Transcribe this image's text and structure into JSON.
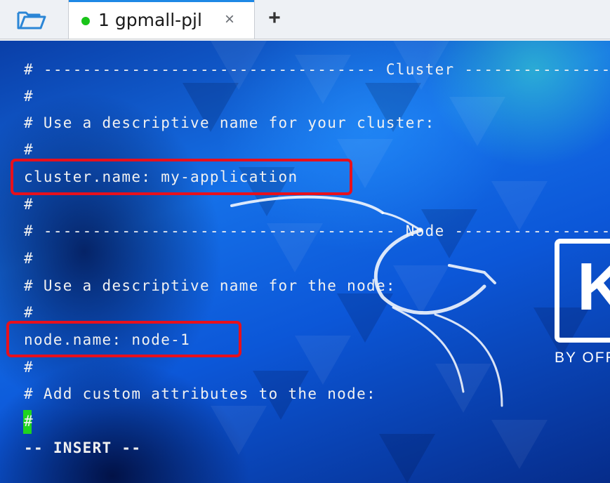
{
  "tabbar": {
    "folder_icon": "folder-open-icon",
    "active_tab": {
      "label": "1 gpmall-pjl",
      "status_color": "#19c419",
      "close_symbol": "×"
    },
    "add_tab_symbol": "+"
  },
  "terminal": {
    "lines": [
      "# ---------------------------------- Cluster -----------------",
      "#",
      "# Use a descriptive name for your cluster:",
      "#",
      "cluster.name: my-application",
      "#",
      "# ------------------------------------ Node ------------------",
      "#",
      "# Use a descriptive name for the node:",
      "#",
      "node.name: node-1",
      "#",
      "# Add custom attributes to the node:",
      "#"
    ],
    "mode_line": "-- INSERT --",
    "highlight_color": "#e8101c",
    "cursor_color": "#1fd41f"
  },
  "wallpaper": {
    "logo_letter": "K",
    "logo_subtitle": "BY OFF"
  }
}
